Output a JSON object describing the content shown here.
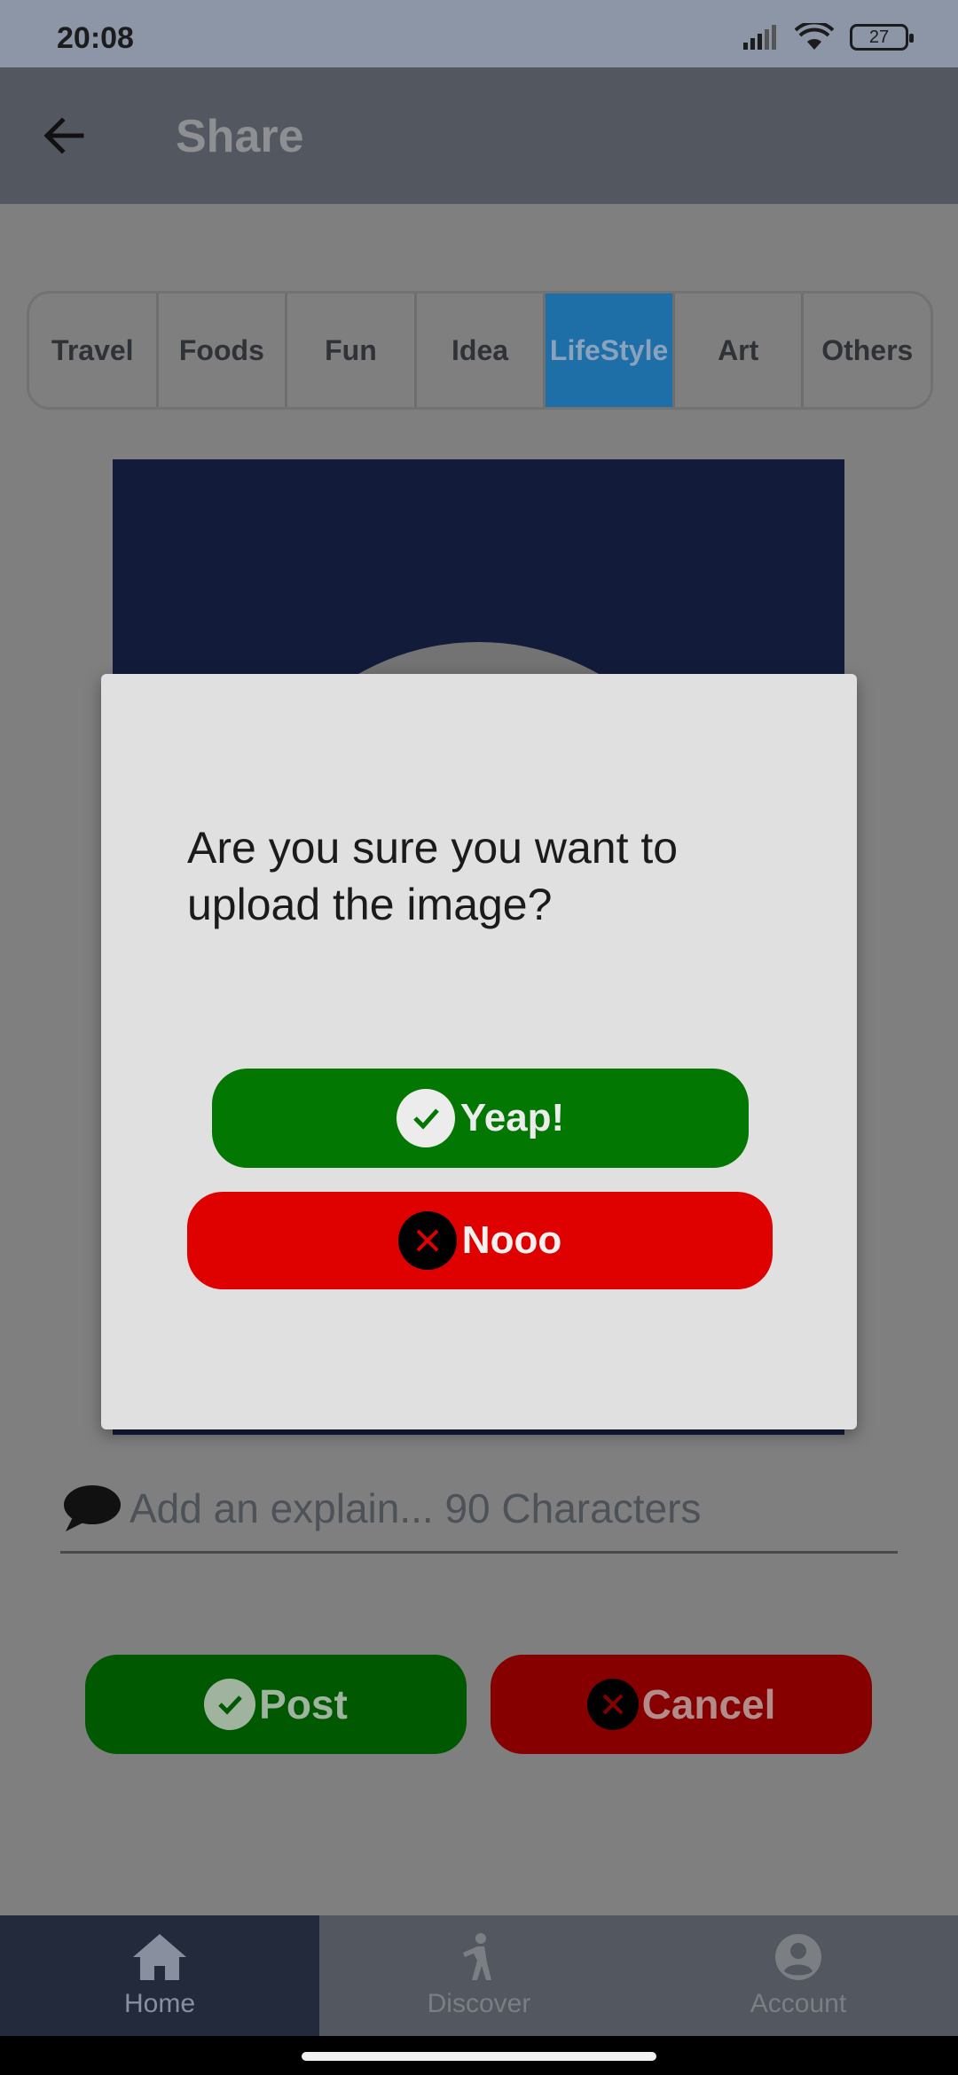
{
  "status_bar": {
    "time": "20:08",
    "battery": "27"
  },
  "app_bar": {
    "title": "Share"
  },
  "tabs": [
    {
      "label": "Travel"
    },
    {
      "label": "Foods"
    },
    {
      "label": "Fun"
    },
    {
      "label": "Idea"
    },
    {
      "label": "LifeStyle",
      "selected": true
    },
    {
      "label": "Art"
    },
    {
      "label": "Others"
    }
  ],
  "explain": {
    "placeholder": "Add an explain... 90 Characters"
  },
  "actions": {
    "post_label": "Post",
    "cancel_label": "Cancel"
  },
  "bottom_nav": [
    {
      "label": "Home",
      "icon": "home-icon",
      "active": true
    },
    {
      "label": "Discover",
      "icon": "walking-person-icon"
    },
    {
      "label": "Account",
      "icon": "account-circle-icon"
    }
  ],
  "dialog": {
    "message": "Are you sure you want to upload the image?",
    "confirm_label": "Yeap!",
    "deny_label": "Nooo"
  },
  "colors": {
    "confirm": "#027702",
    "deny": "#df0000",
    "selected_tab": "#1e6ea8"
  }
}
